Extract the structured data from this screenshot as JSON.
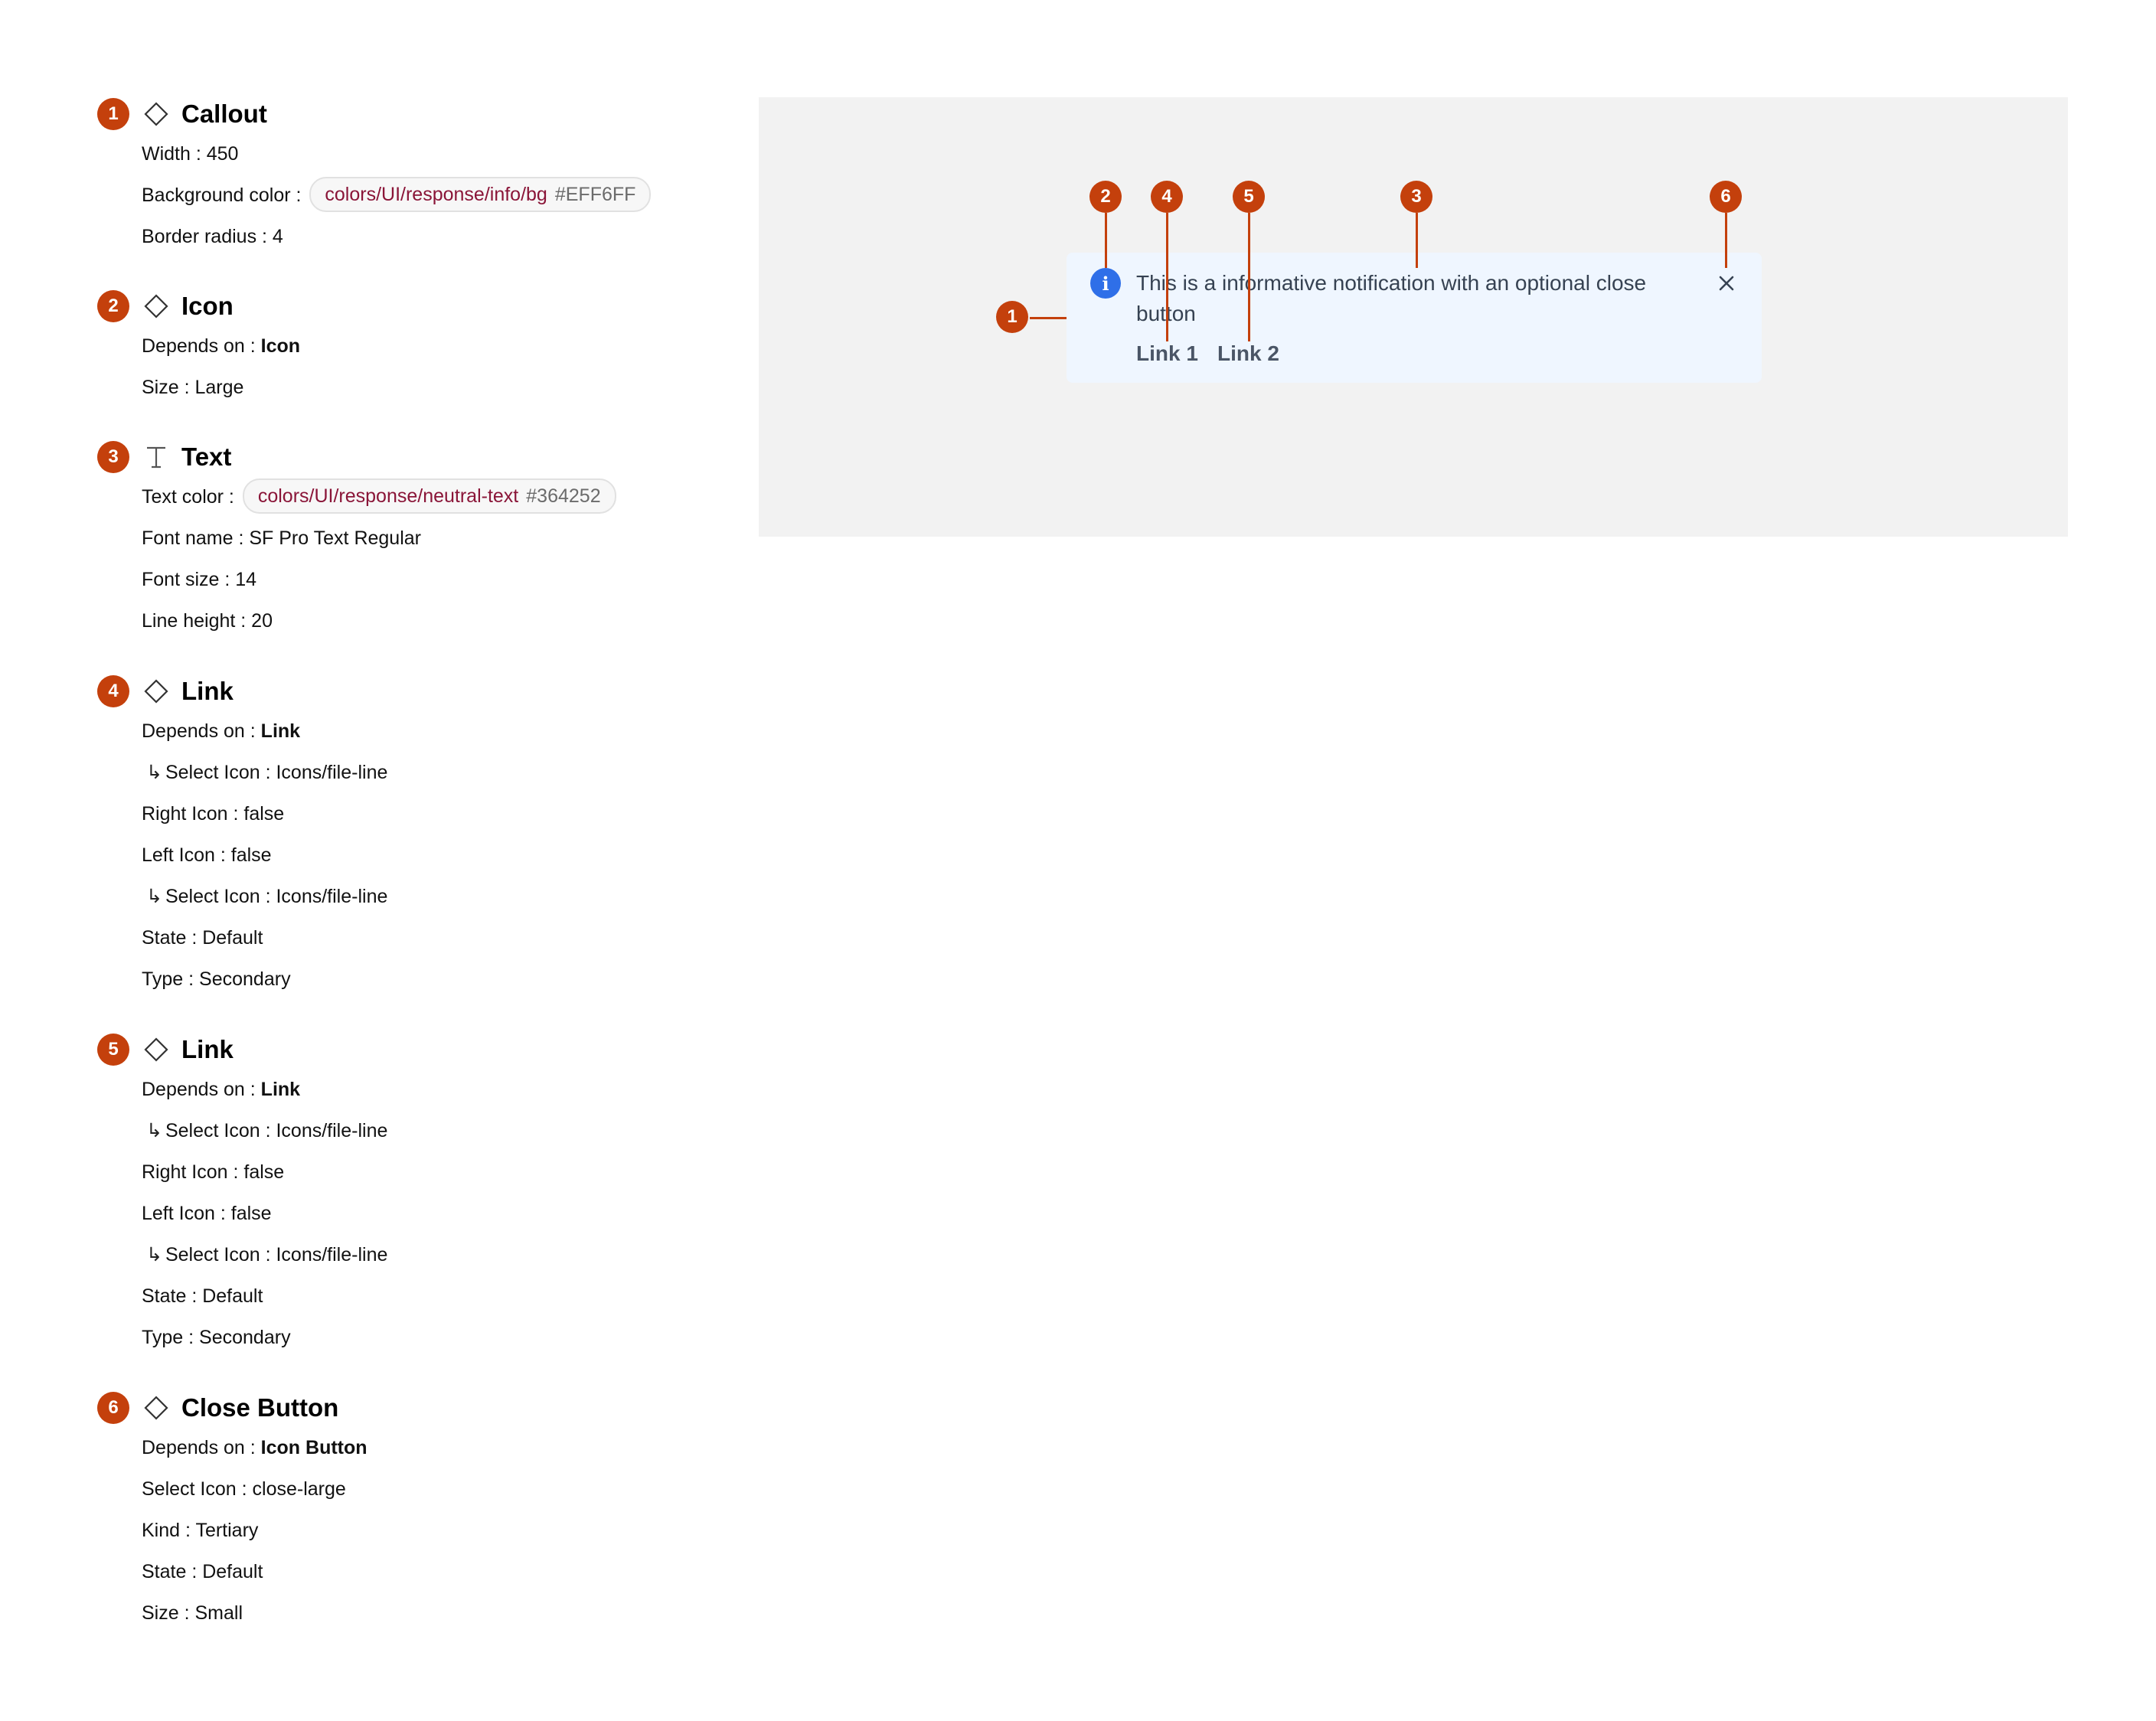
{
  "colors": {
    "marker": "#c4400c",
    "token_name": "#8a1538",
    "callout_bg": "#EFF6FF",
    "callout_text": "#364252",
    "info_icon": "#2f6fe8",
    "preview_bg": "#f2f2f2"
  },
  "specs": {
    "callout": {
      "number": "1",
      "icon": "diamond-icon",
      "title": "Callout",
      "width_label": "Width :",
      "width_value": "450",
      "bg_label": "Background color :",
      "bg_token": "colors/UI/response/info/bg",
      "bg_hex": "#EFF6FF",
      "radius_label": "Border radius :",
      "radius_value": "4"
    },
    "icon": {
      "number": "2",
      "icon": "diamond-icon",
      "title": "Icon",
      "depends_label": "Depends on :",
      "depends_value": "Icon",
      "size_label": "Size :",
      "size_value": "Large"
    },
    "text": {
      "number": "3",
      "icon": "text-t-icon",
      "title": "Text",
      "color_label": "Text color :",
      "color_token": "colors/UI/response/neutral-text",
      "color_hex": "#364252",
      "font_label": "Font name :",
      "font_value": "SF Pro Text Regular",
      "fontsize_label": "Font size :",
      "fontsize_value": "14",
      "lineheight_label": "Line height :",
      "lineheight_value": "20"
    },
    "link1": {
      "number": "4",
      "icon": "diamond-icon",
      "title": "Link",
      "depends_label": "Depends on :",
      "depends_value": "Link",
      "select_icon_label": "Select Icon :",
      "select_icon_value": "Icons/file-line",
      "right_icon_label": "Right Icon :",
      "right_icon_value": "false",
      "left_icon_label": "Left Icon :",
      "left_icon_value": "false",
      "select_icon2_label": "Select Icon :",
      "select_icon2_value": "Icons/file-line",
      "state_label": "State :",
      "state_value": "Default",
      "type_label": "Type :",
      "type_value": "Secondary"
    },
    "link2": {
      "number": "5",
      "icon": "diamond-icon",
      "title": "Link",
      "depends_label": "Depends on :",
      "depends_value": "Link",
      "select_icon_label": "Select Icon :",
      "select_icon_value": "Icons/file-line",
      "right_icon_label": "Right Icon :",
      "right_icon_value": "false",
      "left_icon_label": "Left Icon :",
      "left_icon_value": "false",
      "select_icon2_label": "Select Icon :",
      "select_icon2_value": "Icons/file-line",
      "state_label": "State :",
      "state_value": "Default",
      "type_label": "Type :",
      "type_value": "Secondary"
    },
    "close": {
      "number": "6",
      "icon": "diamond-icon",
      "title": "Close Button",
      "depends_label": "Depends on :",
      "depends_value": "Icon Button",
      "select_icon_label": "Select Icon :",
      "select_icon_value": "close-large",
      "kind_label": "Kind :",
      "kind_value": "Tertiary",
      "state_label": "State :",
      "state_value": "Default",
      "size_label": "Size :",
      "size_value": "Small"
    },
    "sub_arrow": "↳"
  },
  "preview": {
    "info_icon_glyph": "i",
    "message": "This is a informative notification with an optional close button",
    "link1": "Link 1",
    "link2": "Link 2",
    "markers": [
      "1",
      "2",
      "3",
      "4",
      "5",
      "6"
    ]
  }
}
